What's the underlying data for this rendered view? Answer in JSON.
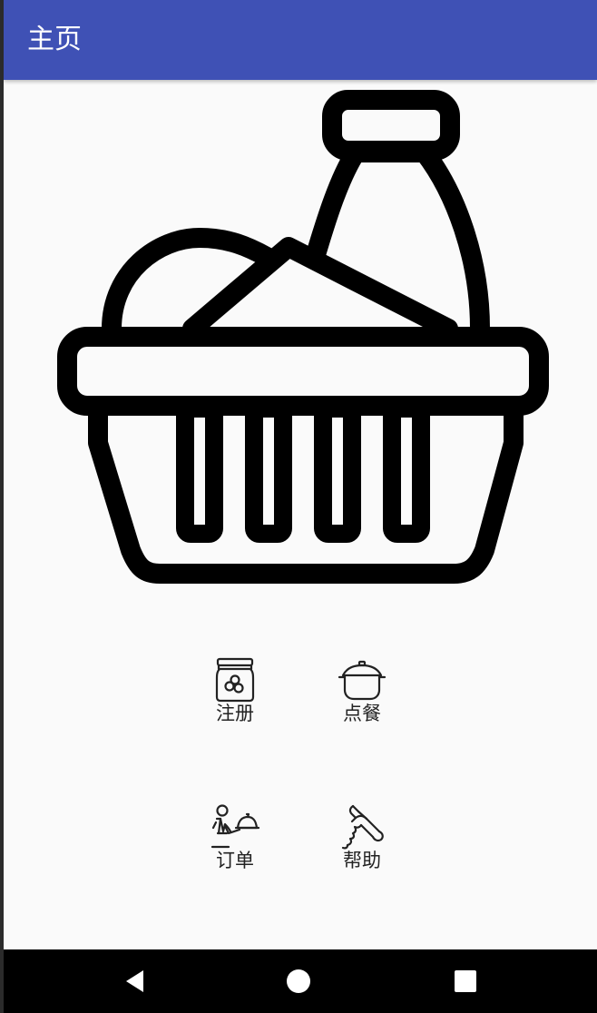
{
  "app_bar": {
    "title": "主页",
    "color": "#3f51b5"
  },
  "hero": {
    "icon": "shopping-basket-icon"
  },
  "menu": [
    {
      "label": "注册",
      "icon": "jar-icon"
    },
    {
      "label": "点餐",
      "icon": "cooking-pot-icon"
    },
    {
      "label": "订单",
      "icon": "waiter-icon"
    },
    {
      "label": "帮助",
      "icon": "corkscrew-icon"
    }
  ],
  "nav_bar": {
    "buttons": [
      "back-icon",
      "home-icon",
      "recents-icon"
    ]
  }
}
